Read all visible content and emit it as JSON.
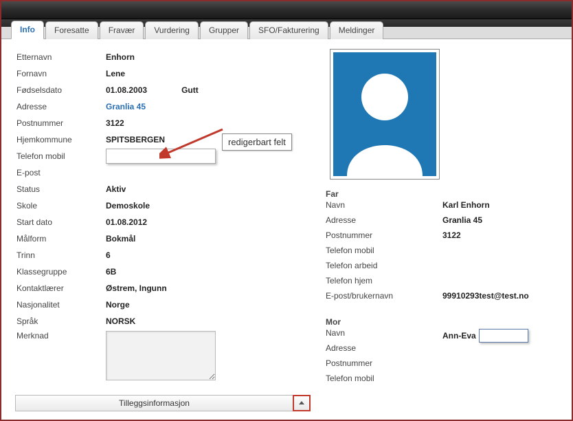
{
  "tabs": [
    "Info",
    "Foresatte",
    "Fravær",
    "Vurdering",
    "Grupper",
    "SFO/Fakturering",
    "Meldinger"
  ],
  "activeTab": 0,
  "labels": {
    "etternavn": "Etternavn",
    "fornavn": "Fornavn",
    "fodselsdato": "Fødselsdato",
    "adresse": "Adresse",
    "postnummer": "Postnummer",
    "hjemkommune": "Hjemkommune",
    "telefon_mobil": "Telefon mobil",
    "epost": "E-post",
    "status": "Status",
    "skole": "Skole",
    "start_dato": "Start dato",
    "malform": "Målform",
    "trinn": "Trinn",
    "klassegruppe": "Klassegruppe",
    "kontaktlaerer": "Kontaktlærer",
    "nasjonalitet": "Nasjonalitet",
    "sprak": "Språk",
    "merknad": "Merknad",
    "far": "Far",
    "mor": "Mor",
    "navn": "Navn",
    "r_adresse": "Adresse",
    "r_postnummer": "Postnummer",
    "r_telefon_mobil": "Telefon mobil",
    "telefon_arbeid": "Telefon arbeid",
    "telefon_hjem": "Telefon hjem",
    "epost_brukernavn": "E-post/brukernavn"
  },
  "student": {
    "etternavn": "Enhorn",
    "fornavn": "Lene",
    "fodselsdato": "01.08.2003",
    "kjonn": "Gutt",
    "adresse": "Granlia 45",
    "postnummer": "3122",
    "hjemkommune": "SPITSBERGEN",
    "telefon_mobil": "",
    "epost": "",
    "status": "Aktiv",
    "skole": "Demoskole",
    "start_dato": "01.08.2012",
    "malform": "Bokmål",
    "trinn": "6",
    "klassegruppe": "6B",
    "kontaktlaerer": "Østrem, Ingunn",
    "nasjonalitet": "Norge",
    "sprak": "NORSK",
    "merknad": ""
  },
  "far": {
    "navn": "Karl Enhorn",
    "adresse": "Granlia 45",
    "postnummer": "3122",
    "telefon_mobil": "",
    "telefon_arbeid": "",
    "telefon_hjem": "",
    "epost_brukernavn": "99910293test@test.no"
  },
  "mor": {
    "navn_prefix": "Ann-Eva",
    "navn_input": "",
    "adresse": "",
    "postnummer": "",
    "telefon_mobil": ""
  },
  "tooltip": "redigerbart felt",
  "expander": "Tilleggsinformasjon"
}
